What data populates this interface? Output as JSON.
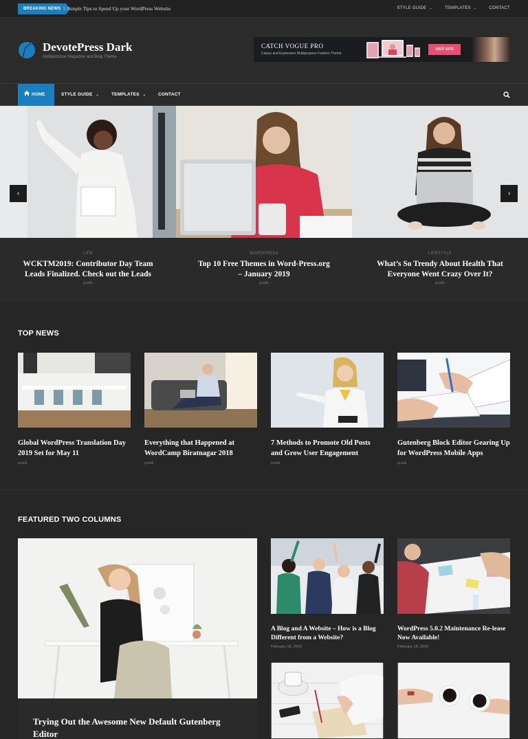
{
  "topbar": {
    "breaking_label": "BREAKING NEWS",
    "ticker": "5 Simple Tips to Speed Up your WordPress Website",
    "menu": [
      "STYLE GUIDE",
      "TEMPLATES",
      "CONTACT"
    ]
  },
  "header": {
    "title": "DevotePress Dark",
    "tagline": "Multipurpose Magazine and Blog Theme",
    "ad": {
      "title": "CATCH VOGUE PRO",
      "subtitle": "Classy and Expressive Multipurpose Fashion Theme",
      "button": "VISIT SITE"
    }
  },
  "nav": {
    "items": [
      "HOME",
      "STYLE GUIDE",
      "TEMPLATES",
      "CONTACT"
    ]
  },
  "slider": {
    "slides": [
      {
        "category": "LIFE",
        "title": "WCKTM2019: Contributor Day Team Leads Finalized. Check out the Leads",
        "author": "pratik"
      },
      {
        "category": "WORDPRESS",
        "title": "Top 10 Free Themes in Word-Press.org – January 2019",
        "author": "pratik"
      },
      {
        "category": "LIFESTYLE",
        "title": "What’s So Trendy About Health That Everyone Went Crazy Over It?",
        "author": "pratik"
      }
    ]
  },
  "top_news": {
    "heading": "TOP NEWS",
    "posts": [
      {
        "title": "Global WordPress Translation Day 2019 Set for May 11",
        "author": "pratik"
      },
      {
        "title": "Everything that Happened at WordCamp Biratnagar 2018",
        "author": "pratik"
      },
      {
        "title": "7 Methods to Promote Old Posts and Grow User Engagement",
        "author": "pratik"
      },
      {
        "title": "Gutenberg Block Editor Gearing Up for WordPress Mobile Apps",
        "author": "pratik"
      }
    ]
  },
  "featured": {
    "heading": "FEATURED TWO COLUMNS",
    "main_title": "Trying Out the Awesome New Default Gutenberg Editor",
    "posts": [
      {
        "title": "A Blog and A Website – How is a Blog Different from a Website?",
        "date": "February 18, 2019"
      },
      {
        "title": "WordPress 5.0.2 Maintenance Re-lease Now Available!",
        "date": "February 18, 2019"
      }
    ]
  },
  "colors": {
    "accent": "#1a7fc1",
    "background": "#262626",
    "ad_button": "#e94f6c"
  }
}
